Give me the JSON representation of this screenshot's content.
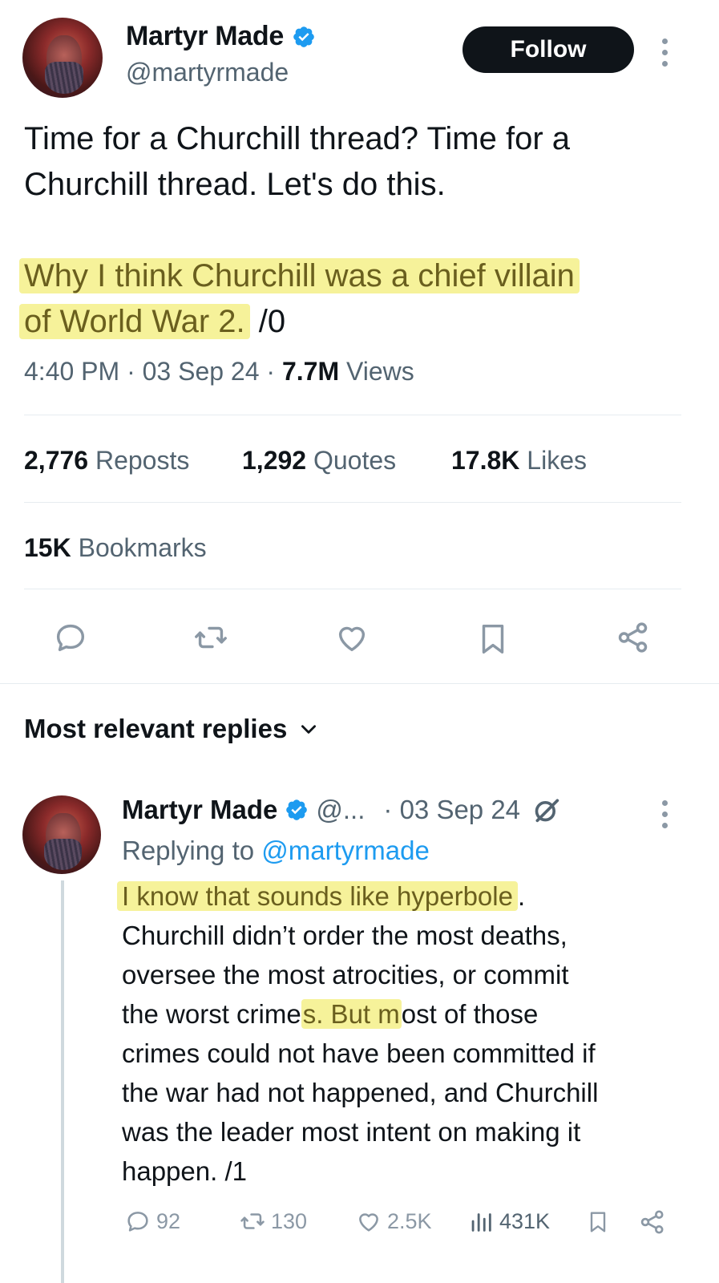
{
  "tweet": {
    "author_name": "Martyr Made",
    "author_handle": "@martyrmade",
    "follow_label": "Follow",
    "text_line1": "Time for a Churchill thread? Time for a",
    "text_line2": "Churchill thread. Let's do this.",
    "highlight_line1": "Why I think Churchill was a chief villain",
    "highlight_line2": "of World War 2.",
    "highlight_suffix": " /0",
    "time": "4:40 PM",
    "date": "03 Sep 24",
    "views_count": "7.7M",
    "views_label": "Views",
    "highlight_color": "#f6f29a"
  },
  "stats": {
    "reposts_count": "2,776",
    "reposts_label": "Reposts",
    "quotes_count": "1,292",
    "quotes_label": "Quotes",
    "likes_count": "17.8K",
    "likes_label": "Likes",
    "bookmarks_count": "15K",
    "bookmarks_label": "Bookmarks"
  },
  "actions": [
    "reply-icon",
    "repost-icon",
    "like-icon",
    "bookmark-icon",
    "share-icon"
  ],
  "replies": {
    "header_label": "Most relevant replies",
    "reply": {
      "author_name": "Martyr Made",
      "handle_truncated": "@...",
      "date": "· 03 Sep 24",
      "replying_prefix": "Replying to",
      "replying_handle": "@martyrmade",
      "line1_highlight": "I know that sounds like hyperbole",
      "line1_rest": ".",
      "line2": "Churchill didn’t order the most deaths,",
      "line3": "oversee the most atrocities, or commit",
      "line4_pre": "the worst crime",
      "line4_hl": "s. But m",
      "line4_post": "ost of those",
      "line5": "crimes could not have been committed if",
      "line6": "the war had not happened, and Churchill",
      "line7": "was the leader most intent on making it",
      "line8": "happen. /1",
      "reply_count": "92",
      "repost_count": "130",
      "like_count": "2.5K",
      "views_count": "431K"
    }
  },
  "colors": {
    "verified_blue": "#1d9bf0",
    "follow_bg": "#0f1419",
    "muted": "#536471"
  }
}
